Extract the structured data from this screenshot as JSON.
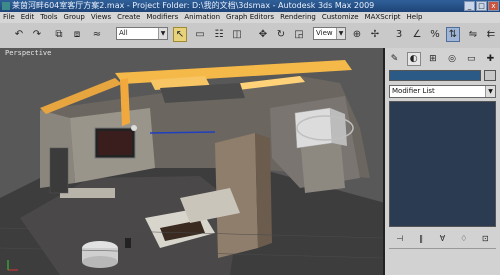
{
  "window": {
    "title": "莱茵河畔604室客厅方案2.max    - Project Folder: D:\\我的文档\\3dsmax    - Autodesk 3ds Max  2009",
    "minimize": "_",
    "maximize": "□",
    "close": "x"
  },
  "menu": [
    "File",
    "Edit",
    "Tools",
    "Group",
    "Views",
    "Create",
    "Modifiers",
    "Animation",
    "Graph Editors",
    "Rendering",
    "Customize",
    "MAXScript",
    "Help"
  ],
  "toolbar": {
    "selection_filter": "All",
    "coord_system": "View",
    "icons": {
      "undo": "↶",
      "redo": "↷",
      "link": "⧉",
      "unlink": "⧈",
      "bind": "≈",
      "select": "↖",
      "select_region": "▭",
      "select_by_name": "☷",
      "window_crossing": "◫",
      "move": "✥",
      "rotate": "↻",
      "scale": "◲",
      "pivot": "⊕",
      "manipulate": "✢",
      "snap3": "3",
      "angle_snap": "∠",
      "percent_snap": "%",
      "spinner_snap": "⇅",
      "named_sel": "⌖",
      "mirror": "⇋",
      "align": "⇇"
    },
    "colors": {
      "select_active": "#e9d27c"
    }
  },
  "viewport": {
    "label": "Perspective"
  },
  "command_panel": {
    "tabs": {
      "create": "✎",
      "modify": "◐",
      "hierarchy": "⊞",
      "motion": "◎",
      "display": "▭",
      "utilities": "✚"
    },
    "modifier_list": "Modifier List",
    "stack_buttons": {
      "pin": "⊣",
      "show_end": "‖",
      "unique": "∀",
      "remove": "♢",
      "configure": "⊡"
    },
    "colors": {
      "name_field": "#2b5a86",
      "stack_bg": "#2a3b52"
    }
  }
}
